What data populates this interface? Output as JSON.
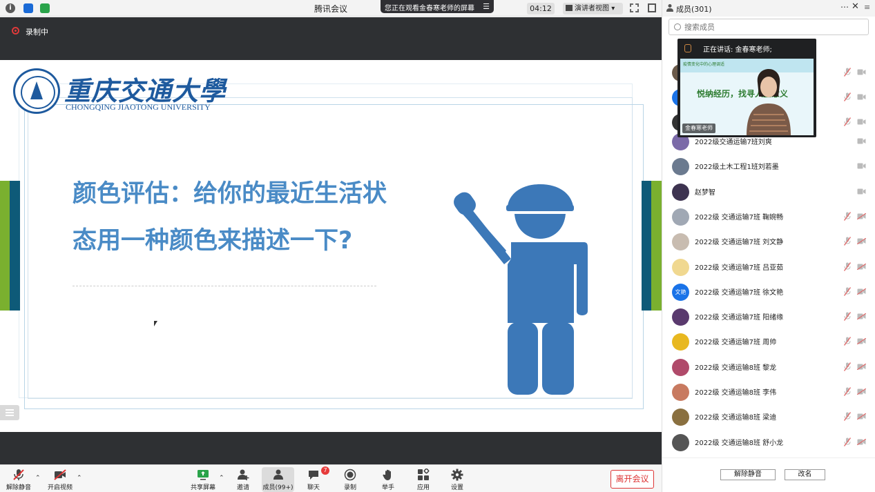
{
  "window": {
    "title": "腾讯会议",
    "watching_banner": "您正在观看金春寒老师的屏幕",
    "timer": "04:12",
    "view_mode": "演讲者视图"
  },
  "recording": {
    "label": "录制中"
  },
  "slide": {
    "university_cn": "重庆交通大學",
    "university_en": "CHONGQING JIAOTONG UNIVERSITY",
    "question_line1": "颜色评估：给你的最近生活状",
    "question_line2": "态用一种颜色来描述一下?",
    "accent_blue": "#4a8bc6",
    "accent_green": "#7ab02f",
    "accent_navy": "#0e5a78"
  },
  "toolbar": {
    "unmute": "解除静音",
    "start_video": "开启视频",
    "share_screen": "共享屏幕",
    "invite": "邀请",
    "members": "成员(99+)",
    "chat": "聊天",
    "chat_badge": "7",
    "record": "录制",
    "raise_hand": "举手",
    "apps": "应用",
    "settings": "设置",
    "leave": "离开会议"
  },
  "panel": {
    "title": "成员(301)",
    "search_placeholder": "搜索成员",
    "speaker_card": {
      "title": "正在讲话: 金春寒老师;",
      "video_heading": "悦纳经历，找寻人生意义",
      "video_subtitle": "疫情变化中的心理调适",
      "name_label": "金春寒老师"
    },
    "members": [
      {
        "name": "2022级交通运输7班刘爽",
        "avatar_text": "",
        "avatar_color": "#7b6aa8",
        "mic": "hidden",
        "cam": "off"
      },
      {
        "name": "2022级土木工程1班刘若墨",
        "avatar_text": "",
        "avatar_color": "#6b7a8f",
        "mic": "hidden",
        "cam": "off"
      },
      {
        "name": "赵梦智",
        "avatar_text": "",
        "avatar_color": "#3d3350",
        "mic": "hidden",
        "cam": "off"
      },
      {
        "name": "2022级 交通运输7班 鞠婉畅",
        "avatar_text": "",
        "avatar_color": "#a0a8b4",
        "mic": "muted",
        "cam": "off"
      },
      {
        "name": "2022级 交通运输7班 刘文静",
        "avatar_text": "",
        "avatar_color": "#c8bcb0",
        "mic": "muted",
        "cam": "off"
      },
      {
        "name": "2022级 交通运输7班 吕亚茹",
        "avatar_text": "",
        "avatar_color": "#f0d890",
        "mic": "muted",
        "cam": "off"
      },
      {
        "name": "2022级 交通运输7班 徐文艳",
        "avatar_text": "文艳",
        "avatar_color": "#1a73e8",
        "mic": "muted",
        "cam": "off"
      },
      {
        "name": "2022级 交通运输7班 阳绪缘",
        "avatar_text": "",
        "avatar_color": "#5a3a6e",
        "mic": "muted",
        "cam": "off"
      },
      {
        "name": "2022级 交通运输7班 周帅",
        "avatar_text": "",
        "avatar_color": "#e8b820",
        "mic": "muted",
        "cam": "off"
      },
      {
        "name": "2022级 交通运输8班 黎龙",
        "avatar_text": "",
        "avatar_color": "#b04a6a",
        "mic": "muted",
        "cam": "off"
      },
      {
        "name": "2022级 交通运输8班 李伟",
        "avatar_text": "",
        "avatar_color": "#c87a60",
        "mic": "muted",
        "cam": "off"
      },
      {
        "name": "2022级 交通运输8班 梁迪",
        "avatar_text": "",
        "avatar_color": "#8a7040",
        "mic": "muted",
        "cam": "off"
      },
      {
        "name": "2022级 交通运输8班 舒小龙",
        "avatar_text": "",
        "avatar_color": "#555555",
        "mic": "muted",
        "cam": "off"
      }
    ],
    "unmute_all": "解除静音",
    "rename": "改名"
  }
}
